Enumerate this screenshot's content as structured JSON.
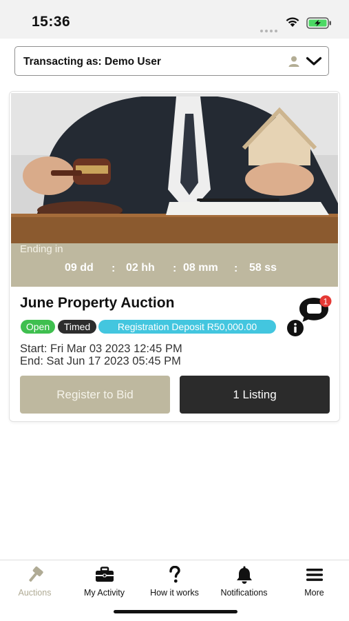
{
  "status_bar": {
    "time": "15:36"
  },
  "account": {
    "label": "Transacting as: Demo User"
  },
  "auction": {
    "ending_label": "Ending in",
    "countdown": {
      "days": "09 dd",
      "hours": "02 hh",
      "minutes": "08 mm",
      "seconds": "58 ss",
      "separator": ":"
    },
    "title": "June Property Auction",
    "badges": {
      "open": "Open",
      "timed": "Timed",
      "deposit": "Registration Deposit R50,000.00"
    },
    "notification_count": "1",
    "start": "Start: Fri Mar 03 2023 12:45 PM",
    "end": "End: Sat Jun 17 2023 05:45 PM",
    "register_button": "Register to Bid",
    "listing_button": "1 Listing"
  },
  "tabs": [
    {
      "label": "Auctions",
      "icon": "gavel-icon",
      "active": true
    },
    {
      "label": "My Activity",
      "icon": "briefcase-icon",
      "active": false
    },
    {
      "label": "How it works",
      "icon": "question-icon",
      "active": false
    },
    {
      "label": "Notifications",
      "icon": "bell-icon",
      "active": false
    },
    {
      "label": "More",
      "icon": "menu-icon",
      "active": false
    }
  ],
  "colors": {
    "accent_khaki": "#beb89f",
    "dark_button": "#2b2b2b",
    "open_badge": "#3fbf4f",
    "timed_badge": "#2d2d2d",
    "deposit_badge": "#43c6df",
    "notification_badge": "#e53935"
  }
}
